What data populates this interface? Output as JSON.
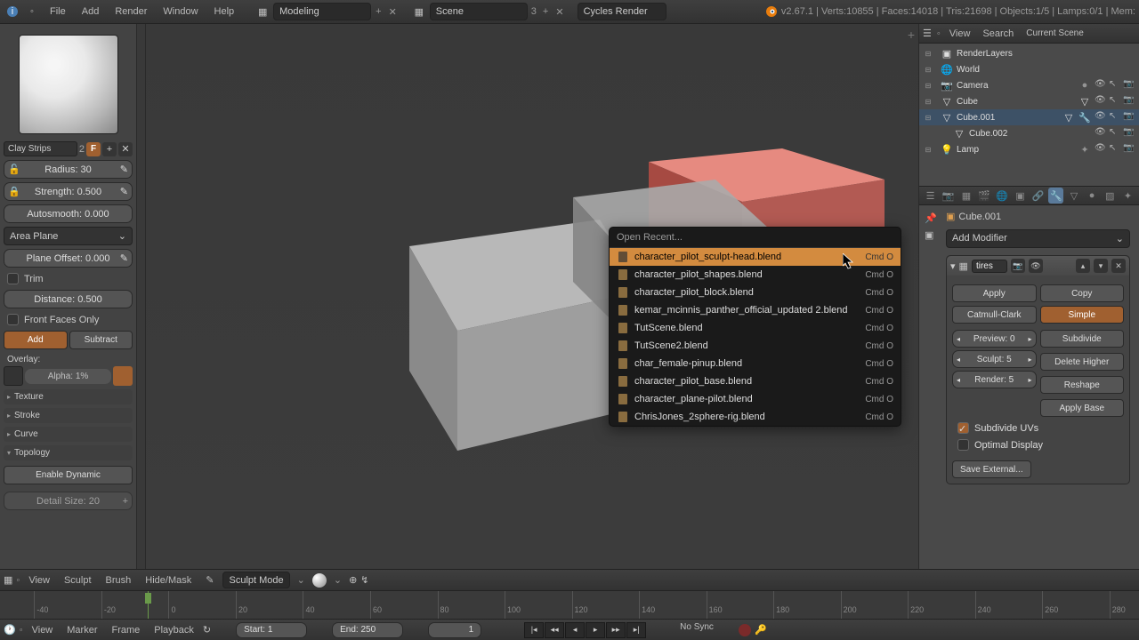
{
  "topbar": {
    "menus": [
      "File",
      "Add",
      "Render",
      "Window",
      "Help"
    ],
    "layout": "Modeling",
    "scene": "Scene",
    "scene_num": "3",
    "engine": "Cycles Render",
    "stats": "v2.67.1 | Verts:10855 | Faces:14018 | Tris:21698 | Objects:1/5 | Lamps:0/1 | Mem:"
  },
  "toolshelf": {
    "brush_name": "Clay Strips",
    "brush_users": "2",
    "radius": "Radius: 30",
    "strength": "Strength: 0.500",
    "autosmooth": "Autosmooth: 0.000",
    "plane": "Area Plane",
    "plane_offset": "Plane Offset: 0.000",
    "trim": "Trim",
    "distance": "Distance: 0.500",
    "front_faces": "Front Faces Only",
    "add": "Add",
    "subtract": "Subtract",
    "overlay_label": "Overlay:",
    "alpha": "Alpha: 1%",
    "panels": [
      "Texture",
      "Stroke",
      "Curve"
    ],
    "topology": "Topology",
    "enable_dynamic": "Enable Dynamic",
    "detail_size": "Detail Size: 20"
  },
  "vp_header": {
    "menus": [
      "View",
      "Sculpt",
      "Brush",
      "Hide/Mask"
    ],
    "mode": "Sculpt Mode"
  },
  "context_menu": {
    "title": "Open Recent...",
    "items": [
      {
        "name": "character_pilot_sculpt-head.blend",
        "sc": "Cmd O",
        "hl": true
      },
      {
        "name": "character_pilot_shapes.blend",
        "sc": "Cmd O"
      },
      {
        "name": "character_pilot_block.blend",
        "sc": "Cmd O"
      },
      {
        "name": "kemar_mcinnis_panther_official_updated 2.blend",
        "sc": "Cmd O"
      },
      {
        "name": "TutScene.blend",
        "sc": "Cmd O"
      },
      {
        "name": "TutScene2.blend",
        "sc": "Cmd O"
      },
      {
        "name": "char_female-pinup.blend",
        "sc": "Cmd O"
      },
      {
        "name": "character_pilot_base.blend",
        "sc": "Cmd O"
      },
      {
        "name": "character_plane-pilot.blend",
        "sc": "Cmd O"
      },
      {
        "name": "ChrisJones_2sphere-rig.blend",
        "sc": "Cmd O"
      }
    ]
  },
  "outliner_header": {
    "items": [
      "View",
      "Search"
    ],
    "scene": "Current Scene"
  },
  "outliner": {
    "rows": [
      {
        "indent": 0,
        "name": "RenderLayers",
        "icon": "layers"
      },
      {
        "indent": 0,
        "name": "World",
        "icon": "world"
      },
      {
        "indent": 0,
        "name": "Camera",
        "icon": "camera",
        "toggles": true
      },
      {
        "indent": 0,
        "name": "Cube",
        "icon": "mesh",
        "toggles": true
      },
      {
        "indent": 0,
        "name": "Cube.001",
        "icon": "mesh",
        "toggles": true,
        "extra": true,
        "selected": true
      },
      {
        "indent": 1,
        "name": "Cube.002",
        "icon": "mesh",
        "toggles": true,
        "child": true
      },
      {
        "indent": 0,
        "name": "Lamp",
        "icon": "lamp",
        "toggles": true
      }
    ]
  },
  "props": {
    "breadcrumb_obj": "Cube.001",
    "add_modifier": "Add Modifier",
    "modifier": {
      "name": "tires",
      "apply": "Apply",
      "copy": "Copy",
      "catmull": "Catmull-Clark",
      "simple": "Simple",
      "preview": "Preview: 0",
      "subdivide": "Subdivide",
      "sculpt": "Sculpt: 5",
      "delete_higher": "Delete Higher",
      "render": "Render: 5",
      "reshape": "Reshape",
      "apply_base": "Apply Base",
      "sub_uvs": "Subdivide UVs",
      "optimal": "Optimal Display",
      "save_ext": "Save External..."
    }
  },
  "timeline": {
    "ticks": [
      "-40",
      "-20",
      "0",
      "20",
      "40",
      "60",
      "80",
      "100",
      "120",
      "140",
      "160",
      "180",
      "200",
      "220",
      "240",
      "260",
      "280"
    ]
  },
  "tl_header": {
    "menus": [
      "View",
      "Marker",
      "Frame",
      "Playback"
    ],
    "start": "Start: 1",
    "end": "End: 250",
    "current": "1",
    "sync": "No Sync"
  }
}
